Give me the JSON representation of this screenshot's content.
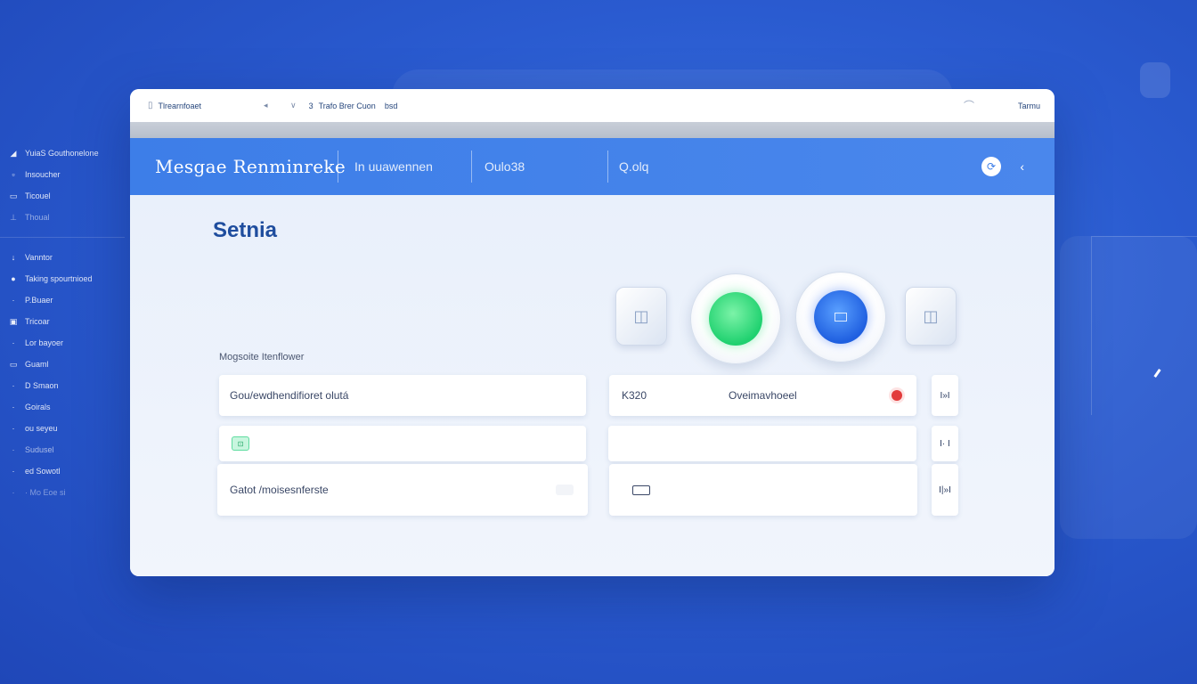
{
  "sidebar": {
    "items_top": [
      {
        "icon": "◢",
        "label": "YuiaS Gouthonelone",
        "icon_name": "wedge-icon"
      },
      {
        "icon": "▫",
        "label": "Insoucher",
        "icon_name": "square-icon"
      },
      {
        "icon": "▭",
        "label": "Ticouel",
        "icon_name": "card-icon"
      },
      {
        "icon": "⊥",
        "label": "Thoual",
        "icon_name": "pin-icon"
      }
    ],
    "items_bottom": [
      {
        "icon": "↓",
        "label": "Vanntor",
        "icon_name": "arrow-down-icon"
      },
      {
        "icon": "●",
        "label": "Taking spourtnioed",
        "icon_name": "person-icon"
      },
      {
        "icon": "·",
        "label": "P.Buaer",
        "icon_name": "dot-icon"
      },
      {
        "icon": "▣",
        "label": "Tricoar",
        "icon_name": "box-icon"
      },
      {
        "icon": "·",
        "label": "Lor bayoer",
        "icon_name": "dot-icon"
      },
      {
        "icon": "▭",
        "label": "Guaml",
        "icon_name": "card-icon"
      },
      {
        "icon": "·",
        "label": "D Smaon",
        "icon_name": "dot-icon"
      },
      {
        "icon": "·",
        "label": "Goirals",
        "icon_name": "dot-icon"
      },
      {
        "icon": "·",
        "label": "ou seyeu",
        "icon_name": "dot-icon"
      },
      {
        "icon": "·",
        "label": "Sudusel",
        "icon_name": "dot-icon"
      },
      {
        "icon": "·",
        "label": "ed Sowotl",
        "icon_name": "dot-icon"
      },
      {
        "icon": "·",
        "label": "· Mo Eoe si",
        "icon_name": "dot-icon"
      }
    ]
  },
  "titlebar": {
    "app_name": "Tlrearnfoaet",
    "path": "Trafo Brer Cuon",
    "path_suffix": "bsd",
    "right_label": "Tarmu"
  },
  "header": {
    "title": "Mesgae Renminreke",
    "tab1": "In uuawennen",
    "tab2": "Oulo38",
    "tab3": "Q.olq"
  },
  "content": {
    "section_title": "Setnia",
    "field_label": "Mogsoite Itenflower",
    "row1_left": "Gou/ewdhendifioret olutá",
    "row1_code": "K320",
    "row1_center": "Oveimavhoeel",
    "row1_mini": "I»I",
    "row2_mini": "I· I",
    "row3_left": "Gatot /moisesnferste",
    "row3_mini": "I|»I"
  }
}
